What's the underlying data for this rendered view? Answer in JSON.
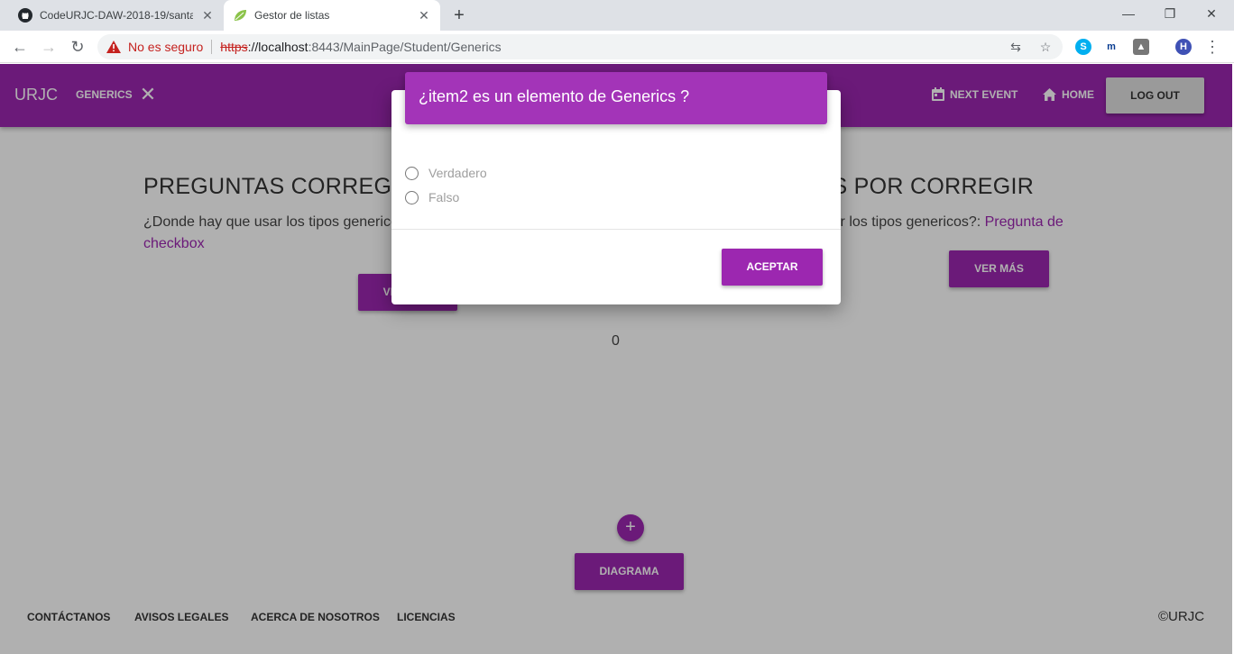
{
  "browser": {
    "tabs": [
      {
        "title": "CodeURJC-DAW-2018-19/santat",
        "icon": "github-icon"
      },
      {
        "title": "Gestor de listas",
        "icon": "spring-leaf-icon"
      }
    ],
    "security_label": "No es seguro",
    "url": {
      "scheme": "https",
      "host": "://localhost",
      "rest": ":8443/MainPage/Student/Generics"
    },
    "profile_initial": "H"
  },
  "navbar": {
    "brand": "URJC",
    "subject": "GENERICS",
    "items": [
      {
        "label": "NEXT EVENT",
        "icon": "calendar-icon"
      },
      {
        "label": "HOME",
        "icon": "home-icon"
      }
    ],
    "logout": "LOG OUT",
    "color": "#9c27b0"
  },
  "main": {
    "corrected": {
      "title": "PREGUNTAS CORREGIDAS",
      "text": "¿Donde hay que usar los tipos genericos?: Pregunta de checkbox",
      "link_suffix": "de checkbox",
      "button": "VER MÁS"
    },
    "pending": {
      "title": "PREGUNTAS POR CORREGIR",
      "text_prefix": "¿Donde hay que usar los tipos genericos?: ",
      "link": "Pregunta de checkbox",
      "button": "VER MÁS"
    },
    "counter": "0",
    "fab": "+",
    "diagram_button": "DIAGRAMA"
  },
  "footer": {
    "links": [
      "CONTÁCTANOS",
      "AVISOS LEGALES",
      "ACERCA DE NOSOTROS",
      "LICENCIAS"
    ],
    "copyright": "©URJC"
  },
  "modal": {
    "title": "¿item2 es un elemento de Generics ?",
    "options": [
      "Verdadero",
      "Falso"
    ],
    "accept": "ACEPTAR"
  }
}
